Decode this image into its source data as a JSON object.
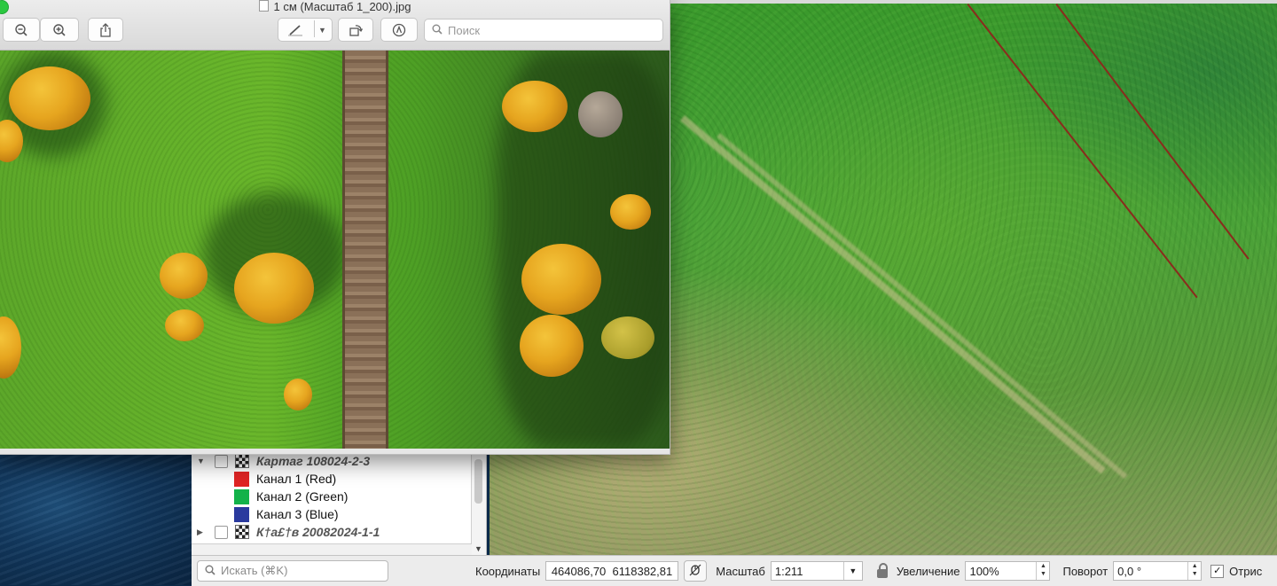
{
  "preview": {
    "title": "1 см (Масштаб 1_200).jpg",
    "search_placeholder": "Поиск",
    "toolbar_icons": [
      "zoom-out-icon",
      "zoom-in-icon",
      "share-icon",
      "markup-pen-icon",
      "rotate-icon",
      "annotate-icon"
    ]
  },
  "layers": {
    "group1_name": "Картаг 108024-2-3",
    "bands": [
      {
        "label": "Канал 1 (Red)",
        "color": "#e02424"
      },
      {
        "label": "Канал 2 (Green)",
        "color": "#13b24a"
      },
      {
        "label": "Канал 3 (Blue)",
        "color": "#2a3a9e"
      }
    ],
    "group2_name": "К†а£†в 20082024-1-1"
  },
  "statusbar": {
    "search_placeholder": "Искать (⌘K)",
    "coords_label": "Координаты",
    "coords_value": "464086,70  6118382,81",
    "scale_label": "Масштаб",
    "scale_value": "1:211",
    "magnifier_label": "Увеличение",
    "magnifier_value": "100%",
    "rotation_label": "Поворот",
    "rotation_value": "0,0 °",
    "render_label": "Отрис",
    "render_checked": true
  }
}
